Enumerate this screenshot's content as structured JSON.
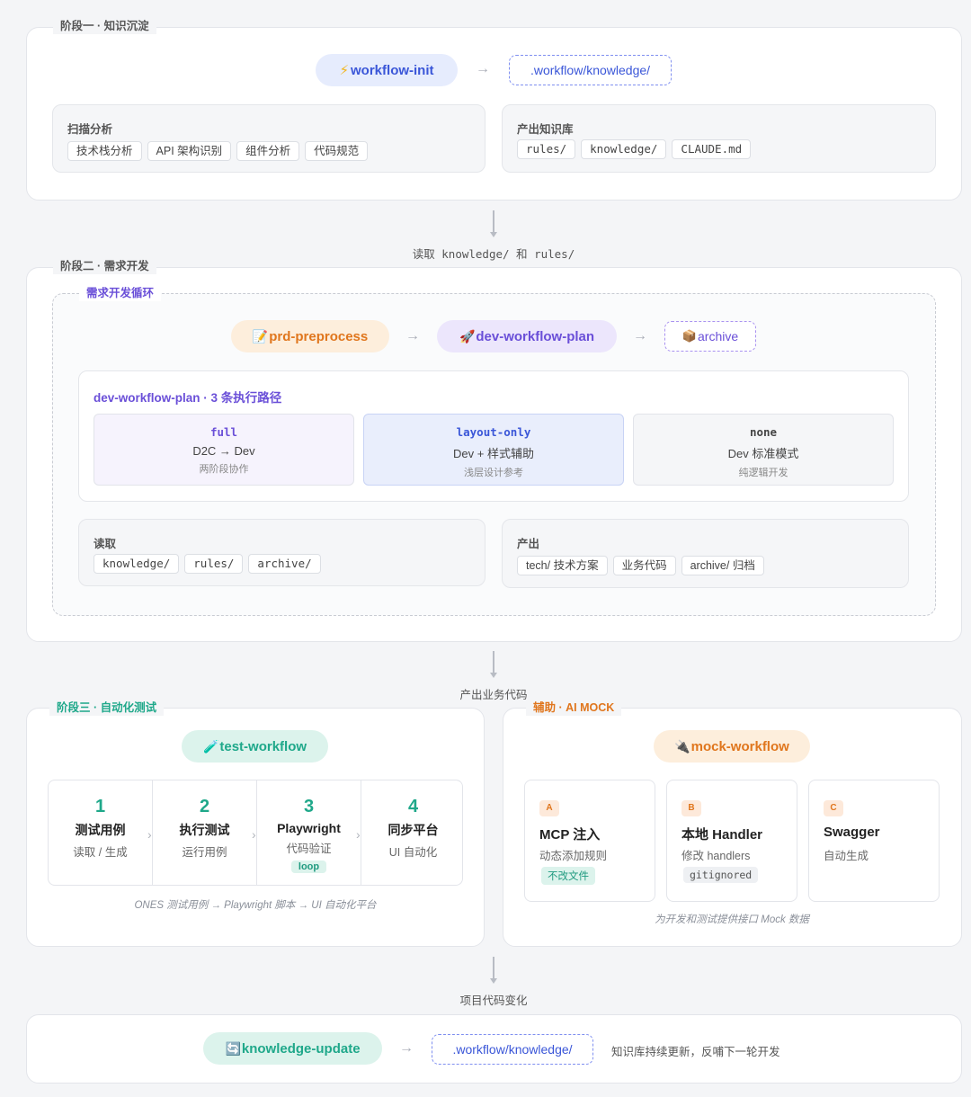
{
  "stage1": {
    "label": "阶段一 · 知识沉淀",
    "init_pill": "workflow-init",
    "init_icon": "lightning-icon",
    "target": ".workflow/knowledge/",
    "scan": {
      "title": "扫描分析",
      "chips": [
        "技术栈分析",
        "API 架构识别",
        "组件分析",
        "代码规范"
      ]
    },
    "output": {
      "title": "产出知识库",
      "chips": [
        "rules/",
        "knowledge/",
        "CLAUDE.md"
      ]
    }
  },
  "conn1": "读取 knowledge/ 和 rules/",
  "stage2": {
    "label": "阶段二 · 需求开发",
    "loop_label": "需求开发循环",
    "pills": {
      "prd": "prd-preprocess",
      "plan": "dev-workflow-plan",
      "archive": "archive"
    },
    "paths_title": "dev-workflow-plan · 3 条执行路径",
    "paths": [
      {
        "name": "full",
        "desc": "D2C → Dev",
        "sub": "两阶段协作"
      },
      {
        "name": "layout-only",
        "desc": "Dev + 样式辅助",
        "sub": "浅层设计参考"
      },
      {
        "name": "none",
        "desc": "Dev 标准模式",
        "sub": "纯逻辑开发"
      }
    ],
    "read": {
      "title": "读取",
      "chips": [
        "knowledge/",
        "rules/",
        "archive/"
      ]
    },
    "output": {
      "title": "产出",
      "chips": [
        "tech/ 技术方案",
        "业务代码",
        "archive/ 归档"
      ]
    }
  },
  "conn2": "产出业务代码",
  "stage3": {
    "label": "阶段三 · 自动化测试",
    "pill": "test-workflow",
    "steps": [
      {
        "num": "1",
        "title": "测试用例",
        "desc": "读取 / 生成"
      },
      {
        "num": "2",
        "title": "执行测试",
        "desc": "运行用例"
      },
      {
        "num": "3",
        "title": "Playwright",
        "desc": "代码验证",
        "tag": "loop"
      },
      {
        "num": "4",
        "title": "同步平台",
        "desc": "UI 自动化"
      }
    ],
    "caption": "ONES 测试用例 → Playwright 脚本 → UI 自动化平台"
  },
  "aux": {
    "label": "辅助 · AI MOCK",
    "pill": "mock-workflow",
    "cards": [
      {
        "badge": "A",
        "title": "MCP 注入",
        "desc": "动态添加规则",
        "tag": "不改文件"
      },
      {
        "badge": "B",
        "title": "本地 Handler",
        "desc": "修改 handlers",
        "tag": "gitignored"
      },
      {
        "badge": "C",
        "title": "Swagger",
        "desc": "自动生成"
      }
    ],
    "caption": "为开发和测试提供接口 Mock 数据"
  },
  "conn3": "项目代码变化",
  "stage4": {
    "pill": "knowledge-update",
    "target": ".workflow/knowledge/",
    "note": "知识库持续更新，反哺下一轮开发"
  },
  "colors": {
    "blue": "#3a56d8",
    "purple": "#6a4fd8",
    "orange": "#e0761d",
    "green": "#1fa88a"
  }
}
